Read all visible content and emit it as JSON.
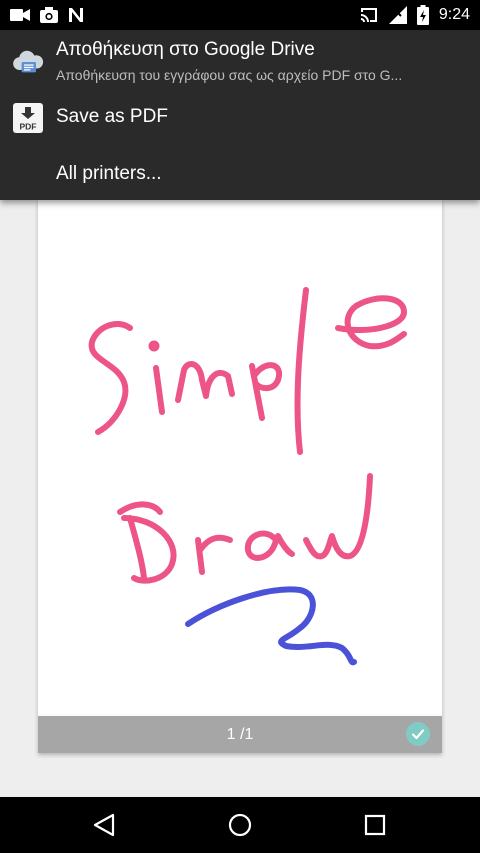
{
  "status_bar": {
    "time": "9:24",
    "left_icons": [
      "videocam-icon",
      "camera-icon",
      "n-notification-icon"
    ],
    "right_icons": [
      "cast-icon",
      "signal-icon",
      "battery-charging-icon"
    ]
  },
  "print_menu": {
    "items": [
      {
        "title": "Αποθήκευση στο Google Drive",
        "subtitle": "Αποθήκευση του εγγράφου σας ως αρχείο PDF στο G...",
        "icon": "cloud-print-icon"
      },
      {
        "title": "Save as PDF",
        "icon": "pdf-download-icon",
        "icon_text": "PDF"
      },
      {
        "title": "All printers..."
      }
    ]
  },
  "preview": {
    "page_number": "1 /1",
    "drawing_text": [
      "Simple",
      "Draw"
    ],
    "colors": {
      "text_stroke": "#ec5585",
      "squiggle_stroke": "#4c52d8",
      "check": "#80cbc4"
    }
  },
  "nav_bar": {
    "buttons": [
      "back-icon",
      "home-icon",
      "recents-icon"
    ]
  }
}
